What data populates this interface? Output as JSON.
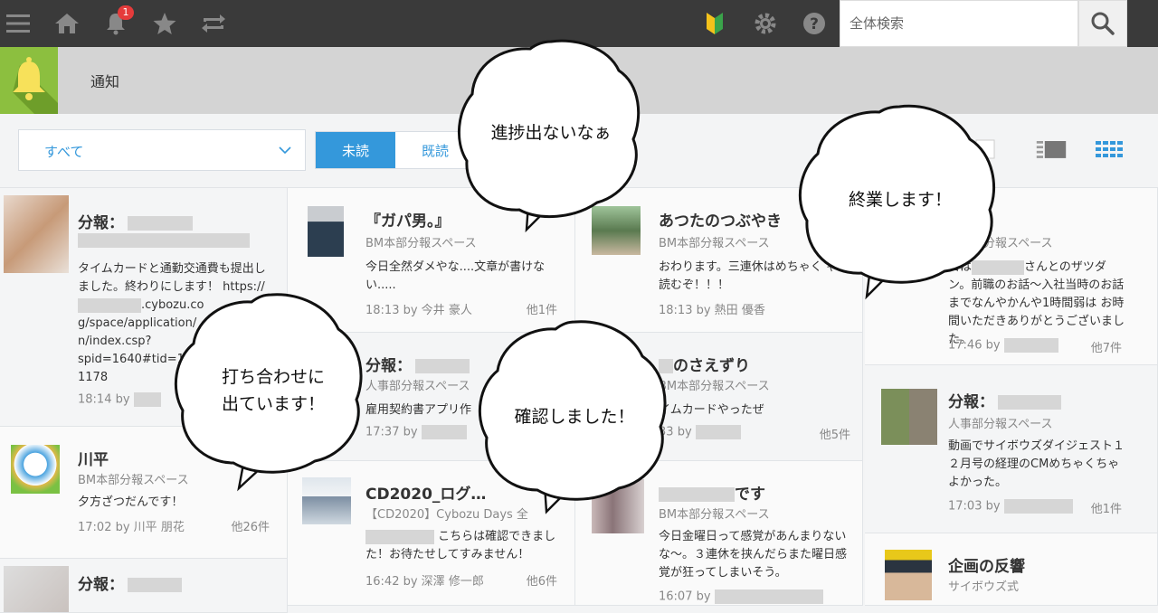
{
  "topbar": {
    "notification_count": "1",
    "search_placeholder": "全体検索"
  },
  "header": {
    "title": "通知"
  },
  "filter": {
    "selected": "すべて"
  },
  "tabs": [
    {
      "label": "未読",
      "active": true
    },
    {
      "label": "既読",
      "active": false
    }
  ],
  "cards": {
    "c1": {
      "title": "分報：",
      "body": "タイムカードと通勤交通費も提出しました。終わりにします！ https://",
      "body2": ".cybozu.co",
      "body3": "g/space/application/",
      "body4": "n/index.csp?",
      "body5": "spid=1640#tid=18",
      "body6": "1178",
      "time": "18:14",
      "by": "by"
    },
    "c2": {
      "title": "川平",
      "space": "BM本部分報スペース",
      "body": "夕方ざつだんです！",
      "time": "17:02",
      "by": "by 川平 朋花",
      "others": "他26件"
    },
    "c3": {
      "title": "分報："
    },
    "c4": {
      "title": "『ガパ男。』",
      "space": "BM本部分報スペース",
      "body": "今日全然ダメやな....文章が書けない.....",
      "time": "18:13",
      "by": "by 今井 豪人",
      "others": "他1件"
    },
    "c5": {
      "title": "分報：",
      "space": "人事部分報スペース",
      "body": "雇用契約書アプリ作",
      "time": "17:37",
      "by": "by"
    },
    "c6": {
      "title": "CD2020_ログ…",
      "space": "【CD2020】Cybozu Days 全",
      "body": "こちらは確認できました！お待たせしてすみません！",
      "time": "16:42",
      "by": "by 深澤 修一郎",
      "others": "他6件"
    },
    "c7": {
      "title": "あつたのつぶやき",
      "space": "BM本部分報スペース",
      "body": "おわります。三連休はめちゃく ゃ本読むぞ！！！",
      "time": "18:13",
      "by": "by 熱田 優香"
    },
    "c8": {
      "title": "のさえずり",
      "space": "BM本部分報スペース",
      "body": "イムカードやったぜ",
      "time": "33",
      "by": "by",
      "others": "他5件"
    },
    "c9": {
      "title": "です",
      "space": "BM本部分報スペース",
      "body": "今日金曜日って感覚があんまりないな〜。３連休を挟んだらまた曜日感覚が狂ってしまいそう。",
      "time": "16:07",
      "by": "by"
    },
    "c10": {
      "space": "人事部分報スペース",
      "body": "日は",
      "body2": "さんとのザツダン。前職のお話〜入社当時のお話までなんやかんや1時間弱は お時間いただきありがとうございました。",
      "time": "17:46",
      "by": "by",
      "others": "他7件"
    },
    "c11": {
      "title": "分報：",
      "space": "人事部分報スペース",
      "body": "動画でサイボウズダイジェスト１２月号の経理のCMめちゃくちゃよかった。",
      "time": "17:03",
      "by": "by",
      "others": "他1件"
    },
    "c12": {
      "title": "企画の反響",
      "space": "サイボウズ式"
    }
  },
  "bubbles": [
    {
      "text": "進捗出ないなぁ"
    },
    {
      "text": "終業します！"
    },
    {
      "text": "打ち合わせに\n出ています！"
    },
    {
      "text": "確認しました！"
    }
  ],
  "colors": {
    "accent": "#3498db",
    "bell_tile": "#8cbf3f",
    "topbar": "#3a3a3a",
    "badge": "#e53b3b"
  }
}
